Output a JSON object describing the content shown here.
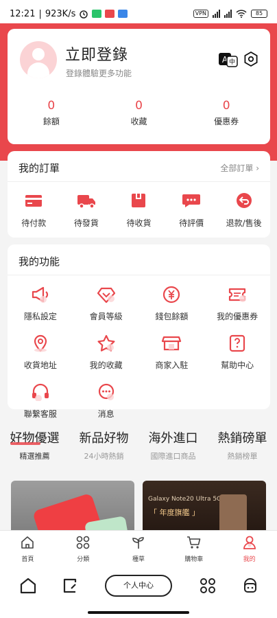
{
  "status_bar": {
    "time": "12:21",
    "speed": "923K/s",
    "vpn": "VPN",
    "battery": "85"
  },
  "profile": {
    "login_title": "立即登錄",
    "login_subtitle": "登錄體驗更多功能",
    "stats": [
      {
        "value": "0",
        "label": "餘額"
      },
      {
        "value": "0",
        "label": "收藏"
      },
      {
        "value": "0",
        "label": "優惠券"
      }
    ]
  },
  "orders": {
    "title": "我的訂單",
    "all_link": "全部訂單 ›",
    "items": [
      {
        "label": "待付款",
        "icon": "wallet-icon"
      },
      {
        "label": "待發貨",
        "icon": "truck-icon"
      },
      {
        "label": "待收貨",
        "icon": "box-icon"
      },
      {
        "label": "待評價",
        "icon": "chat-icon"
      },
      {
        "label": "退款/售後",
        "icon": "return-icon"
      }
    ]
  },
  "functions": {
    "title": "我的功能",
    "items": [
      {
        "label": "隱私設定",
        "icon": "megaphone-icon"
      },
      {
        "label": "會員等級",
        "icon": "diamond-icon"
      },
      {
        "label": "錢包餘額",
        "icon": "yen-coin-icon"
      },
      {
        "label": "我的優惠券",
        "icon": "coupon-icon"
      },
      {
        "label": "收貨地址",
        "icon": "location-icon"
      },
      {
        "label": "我的收藏",
        "icon": "star-icon"
      },
      {
        "label": "商家入駐",
        "icon": "store-icon"
      },
      {
        "label": "幫助中心",
        "icon": "help-icon"
      },
      {
        "label": "聯繫客服",
        "icon": "headset-icon"
      },
      {
        "label": "消息",
        "icon": "message-icon"
      }
    ]
  },
  "categories": [
    {
      "title": "好物優選",
      "subtitle": "精選推薦"
    },
    {
      "title": "新品好物",
      "subtitle": "24小時熱銷"
    },
    {
      "title": "海外進口",
      "subtitle": "國際進口商品"
    },
    {
      "title": "熱銷磅單",
      "subtitle": "熱銷榜單"
    }
  ],
  "products": {
    "b_title": "Galaxy Note20 Ultra 5G",
    "b_badge": "「 年度旗艦 」"
  },
  "bottom_nav": [
    {
      "label": "首頁",
      "icon": "home-icon"
    },
    {
      "label": "分類",
      "icon": "grid-icon"
    },
    {
      "label": "種草",
      "icon": "sprout-icon"
    },
    {
      "label": "購物車",
      "icon": "cart-icon"
    },
    {
      "label": "我的",
      "icon": "user-icon"
    }
  ],
  "system_nav": {
    "center_label": "个人中心"
  },
  "colors": {
    "accent": "#e9474c",
    "avatar_bg": "#fbd3d5",
    "page_bg": "#f4f4f4"
  }
}
